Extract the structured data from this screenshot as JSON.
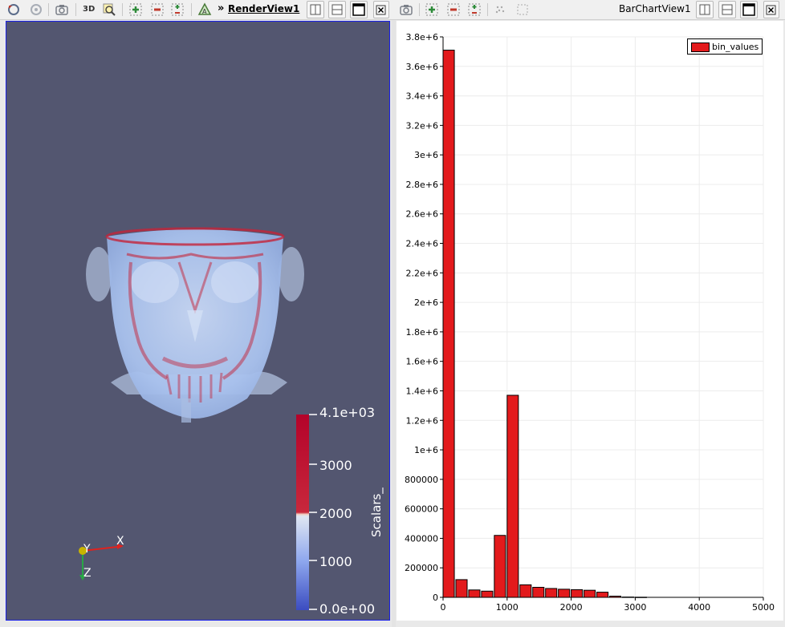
{
  "render_view": {
    "title": "RenderView1",
    "prefix": "»",
    "mode_3d_label": "3D",
    "colorbar": {
      "title": "Scalars_",
      "labels": [
        "4.1e+03",
        "3000",
        "2000",
        "1000",
        "0.0e+00"
      ]
    },
    "axes": {
      "x": "X",
      "y": "Y",
      "z": "Z"
    }
  },
  "chart_view": {
    "title": "BarChartView1"
  },
  "chart_data": {
    "type": "bar",
    "series": [
      {
        "name": "bin_values",
        "color": "#e31a1c"
      }
    ],
    "bins": [
      {
        "x_start": 0,
        "x_end": 176,
        "value": 3710000
      },
      {
        "x_start": 200,
        "x_end": 376,
        "value": 120000
      },
      {
        "x_start": 400,
        "x_end": 576,
        "value": 50000
      },
      {
        "x_start": 600,
        "x_end": 776,
        "value": 42000
      },
      {
        "x_start": 800,
        "x_end": 976,
        "value": 420000
      },
      {
        "x_start": 1000,
        "x_end": 1176,
        "value": 1370000
      },
      {
        "x_start": 1200,
        "x_end": 1376,
        "value": 85000
      },
      {
        "x_start": 1400,
        "x_end": 1576,
        "value": 68000
      },
      {
        "x_start": 1600,
        "x_end": 1776,
        "value": 60000
      },
      {
        "x_start": 1800,
        "x_end": 1976,
        "value": 55000
      },
      {
        "x_start": 2000,
        "x_end": 2176,
        "value": 52000
      },
      {
        "x_start": 2200,
        "x_end": 2376,
        "value": 48000
      },
      {
        "x_start": 2400,
        "x_end": 2576,
        "value": 35000
      },
      {
        "x_start": 2600,
        "x_end": 2776,
        "value": 8000
      },
      {
        "x_start": 2800,
        "x_end": 2976,
        "value": 2000
      },
      {
        "x_start": 3000,
        "x_end": 3176,
        "value": 1000
      }
    ],
    "xlim": [
      0,
      5000
    ],
    "ylim": [
      0,
      3800000
    ],
    "xticks": [
      0,
      1000,
      2000,
      3000,
      4000,
      5000
    ],
    "xtick_labels": [
      "0",
      "1000",
      "2000",
      "3000",
      "4000",
      "5000"
    ],
    "yticks": [
      0,
      200000,
      400000,
      600000,
      800000,
      1000000,
      1200000,
      1400000,
      1600000,
      1800000,
      2000000,
      2200000,
      2400000,
      2600000,
      2800000,
      3000000,
      3200000,
      3400000,
      3600000,
      3800000
    ],
    "ytick_labels": [
      "0",
      "200000",
      "400000",
      "600000",
      "800000",
      "1e+6",
      "1.2e+6",
      "1.4e+6",
      "1.6e+6",
      "1.8e+6",
      "2e+6",
      "2.2e+6",
      "2.4e+6",
      "2.6e+6",
      "2.8e+6",
      "3e+6",
      "3.2e+6",
      "3.4e+6",
      "3.6e+6",
      "3.8e+6"
    ],
    "grid": true,
    "legend_position": "top-right"
  }
}
